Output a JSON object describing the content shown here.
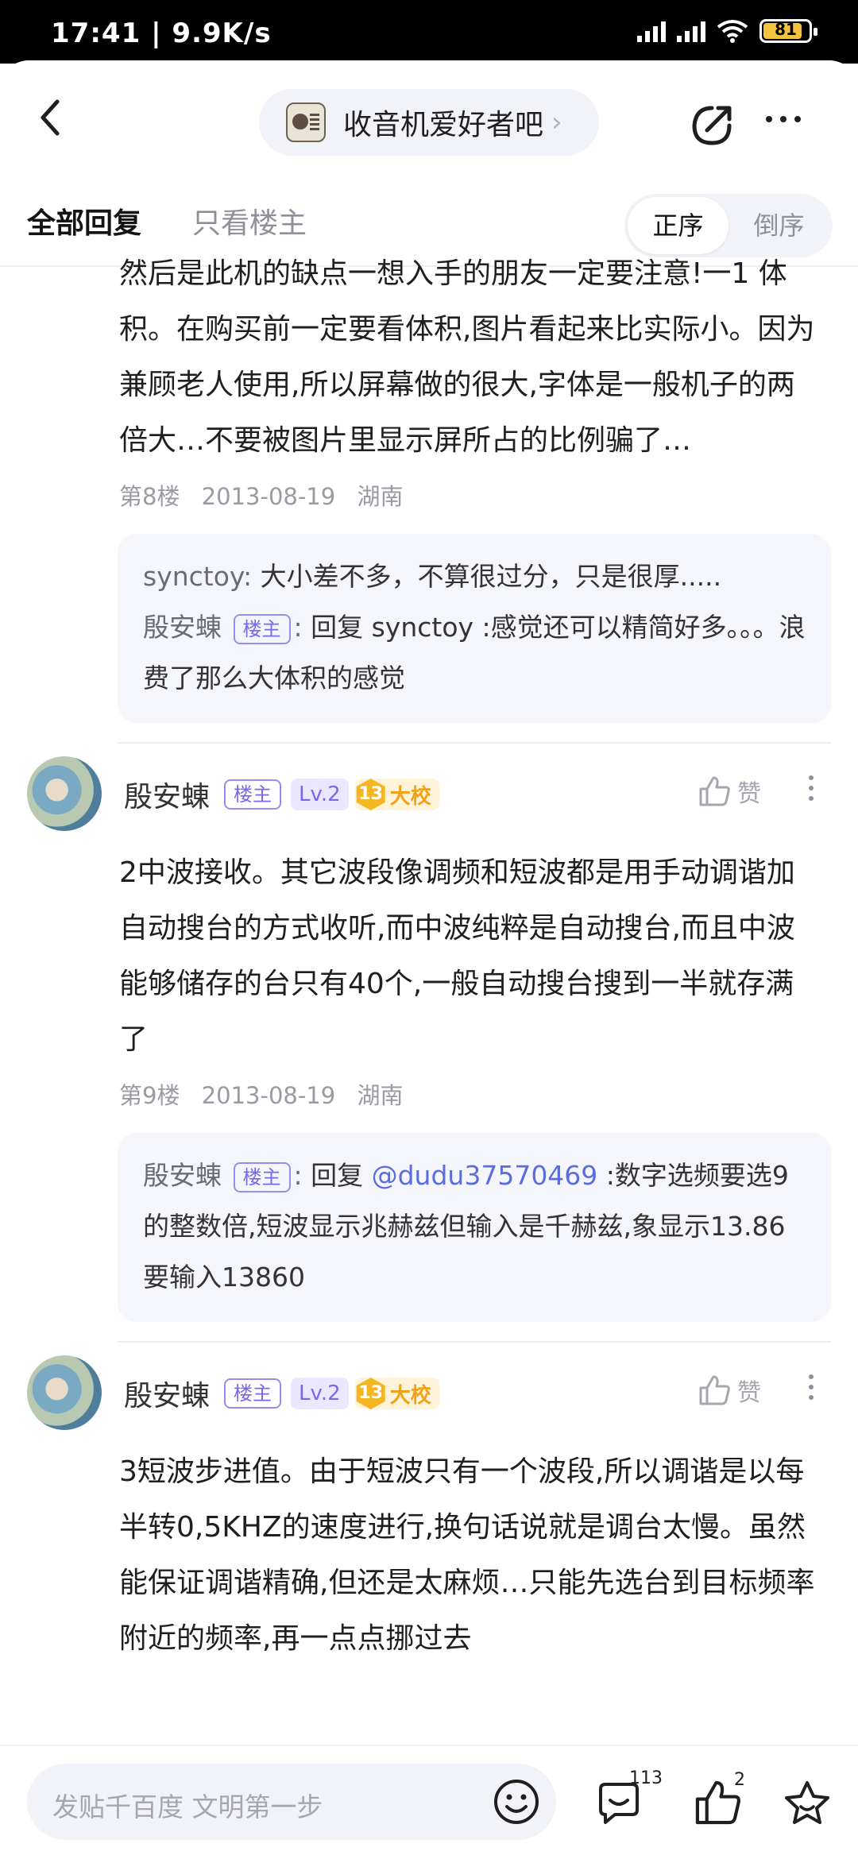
{
  "status_bar": {
    "time_speed": "17:41 | 9.9K/s",
    "battery": "81"
  },
  "header": {
    "forum_name": "收音机爱好者吧"
  },
  "tabs": [
    {
      "label": "全部回复",
      "active": true
    },
    {
      "label": "只看楼主",
      "active": false
    }
  ],
  "order": [
    {
      "label": "正序",
      "active": true
    },
    {
      "label": "倒序",
      "active": false
    }
  ],
  "posts": [
    {
      "text": "然后是此机的缺点一想入手的朋友一定要注意!一1 体积。在购买前一定要看体积,图片看起来比实际小。因为兼顾老人使用,所以屏幕做的很大,字体是一般机子的两倍大…不要被图片里显示屏所占的比例骗了…",
      "floor": "第8楼",
      "date": "2013-08-19",
      "location": "湖南",
      "replies": [
        {
          "user": "synctoy",
          "sep": ": ",
          "text": "大小差不多，不算很过分，只是很厚....."
        },
        {
          "user": "殷安蝀",
          "tag": "楼主",
          "sep": ": ",
          "text": "回复 synctoy :感觉还可以精简好多。。。浪费了那么大体积的感觉"
        }
      ]
    },
    {
      "author": "殷安蝀",
      "author_tag": "楼主",
      "level": "Lv.2",
      "rank_num": "13",
      "rank_name": "大校",
      "like_label": "赞",
      "text": "2中波接收。其它波段像调频和短波都是用手动调谐加自动搜台的方式收听,而中波纯粹是自动搜台,而且中波能够储存的台只有40个,一般自动搜台搜到一半就存满了",
      "floor": "第9楼",
      "date": "2013-08-19",
      "location": "湖南",
      "replies": [
        {
          "user": "殷安蝀",
          "tag": "楼主",
          "sep": ": ",
          "prefix": "回复 ",
          "mention": "@dudu37570469",
          "text": " :数字选频要选9的整数倍,短波显示兆赫兹但输入是千赫兹,象显示13.86要输入13860"
        }
      ]
    },
    {
      "author": "殷安蝀",
      "author_tag": "楼主",
      "level": "Lv.2",
      "rank_num": "13",
      "rank_name": "大校",
      "like_label": "赞",
      "text": "3短波步进值。由于短波只有一个波段,所以调谐是以每半转0,5KHZ的速度进行,换句话说就是调台太慢。虽然能保证调谐精确,但还是太麻烦…只能先选台到目标频率附近的频率,再一点点挪过去"
    }
  ],
  "bottom": {
    "placeholder": "发贴千百度 文明第一步",
    "comment_count": "113",
    "like_count": "2"
  },
  "colors": {
    "accent": "#7a66f0",
    "mention": "#5b6dde",
    "rank": "#f5b623"
  }
}
